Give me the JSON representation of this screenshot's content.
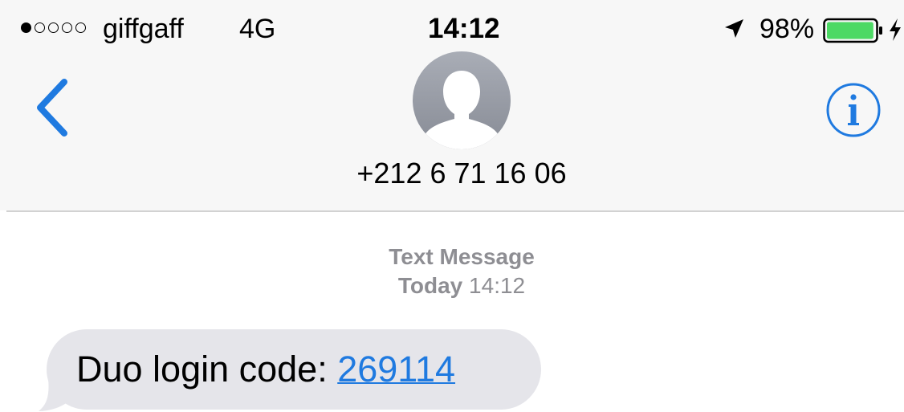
{
  "status_bar": {
    "signal_strength": 1,
    "signal_max": 5,
    "carrier": "giffgaff",
    "network": "4G",
    "time": "14:12",
    "battery_percent": "98%",
    "battery_level": 0.98,
    "battery_color": "#4cd964",
    "charging": true,
    "location_active": true
  },
  "nav": {
    "back_icon": "chevron-left-icon",
    "contact_number": "+212 6 71 16 06",
    "avatar_icon": "person-silhouette-icon",
    "info_icon": "info-icon",
    "accent_color": "#1f7ae0"
  },
  "thread": {
    "service_label": "Text Message",
    "date_label": "Today",
    "time_label": "14:12",
    "messages": [
      {
        "direction": "incoming",
        "text": "Duo login code: ",
        "link": "269114",
        "bubble_color": "#e5e5ea"
      }
    ]
  }
}
